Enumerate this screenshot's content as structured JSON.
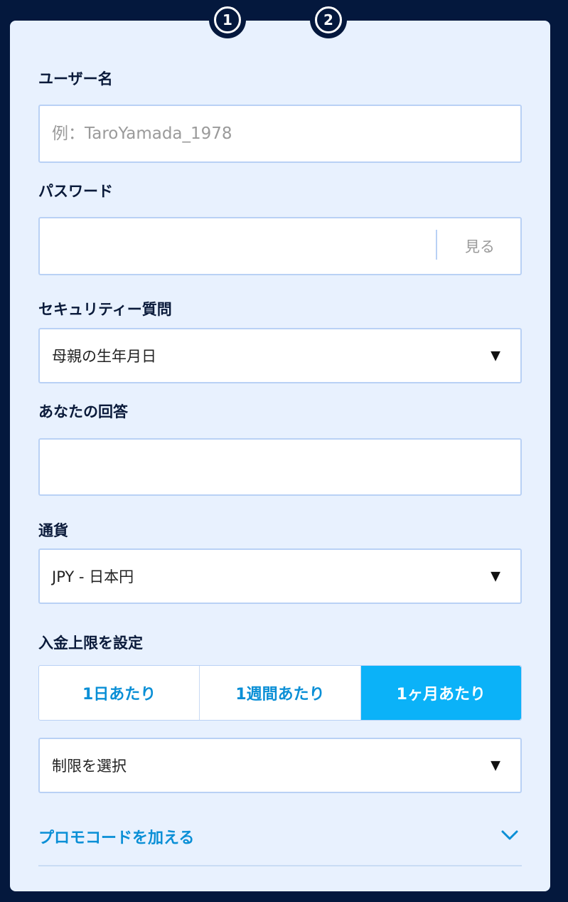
{
  "steps": [
    "1",
    "2"
  ],
  "form": {
    "username": {
      "label": "ユーザー名",
      "placeholder": "例：TaroYamada_1978"
    },
    "password": {
      "label": "パスワード",
      "show_label": "見る"
    },
    "security_question": {
      "label": "セキュリティー質問",
      "selected": "母親の生年月日"
    },
    "answer": {
      "label": "あなたの回答"
    },
    "currency": {
      "label": "通貨",
      "selected": "JPY - 日本円"
    },
    "deposit_limit": {
      "label": "入金上限を設定",
      "tabs": [
        "1日あたり",
        "1週間あたり",
        "1ヶ月あたり"
      ],
      "active_tab": 2,
      "limit_select": "制限を選択"
    },
    "promo": {
      "label": "プロモコードを加える"
    }
  },
  "icons": {
    "dropdown_caret": "▼",
    "promo_chevron": "chevron-down-icon"
  },
  "colors": {
    "background": "#04183d",
    "card": "#e8f1fe",
    "accent": "#0bb2f8",
    "link": "#0a8fd6"
  }
}
